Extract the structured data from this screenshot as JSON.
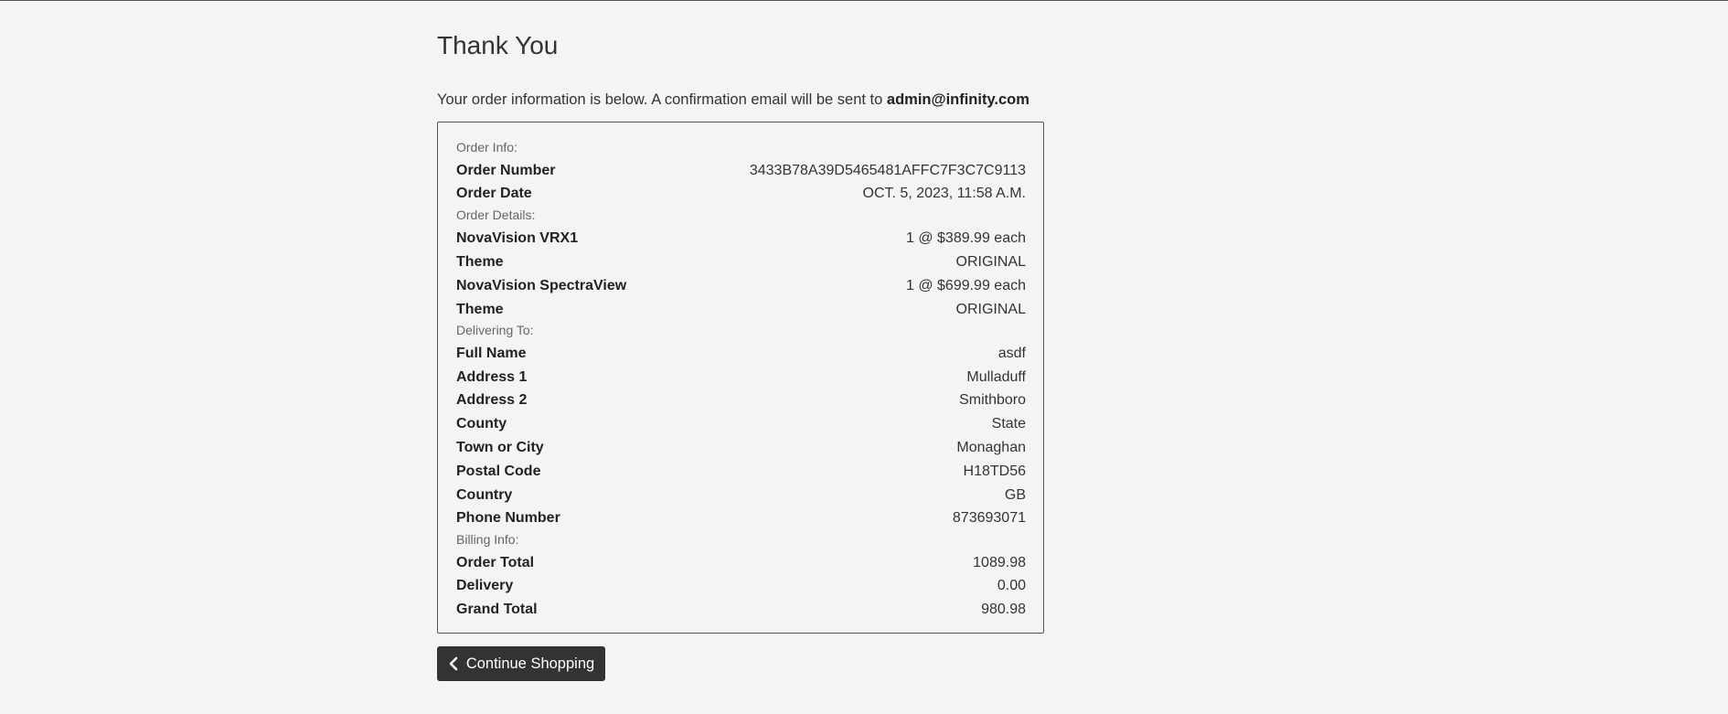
{
  "page": {
    "title": "Thank You",
    "intro_text": "Your order information is below. A confirmation email will be sent to ",
    "email": "admin@infinity.com"
  },
  "order_info": {
    "heading": "Order Info:",
    "rows": [
      {
        "label": "Order Number",
        "value": "3433B78A39D5465481AFFC7F3C7C9113"
      },
      {
        "label": "Order Date",
        "value": "OCT. 5, 2023, 11:58 A.M."
      }
    ]
  },
  "order_details": {
    "heading": "Order Details:",
    "rows": [
      {
        "label": "NovaVision VRX1",
        "value": "1 @ $389.99 each"
      },
      {
        "label": "Theme",
        "value": "ORIGINAL"
      },
      {
        "label": "NovaVision SpectraView",
        "value": "1 @ $699.99 each"
      },
      {
        "label": "Theme",
        "value": "ORIGINAL"
      }
    ]
  },
  "delivering_to": {
    "heading": "Delivering To:",
    "rows": [
      {
        "label": "Full Name",
        "value": "asdf"
      },
      {
        "label": "Address 1",
        "value": "Mulladuff"
      },
      {
        "label": "Address 2",
        "value": "Smithboro"
      },
      {
        "label": "County",
        "value": "State"
      },
      {
        "label": "Town or City",
        "value": "Monaghan"
      },
      {
        "label": "Postal Code",
        "value": "H18TD56"
      },
      {
        "label": "Country",
        "value": "GB"
      },
      {
        "label": "Phone Number",
        "value": "873693071"
      }
    ]
  },
  "billing_info": {
    "heading": "Billing Info:",
    "rows": [
      {
        "label": "Order Total",
        "value": "1089.98"
      },
      {
        "label": "Delivery",
        "value": "0.00"
      },
      {
        "label": "Grand Total",
        "value": "980.98"
      }
    ]
  },
  "actions": {
    "continue_label": "Continue Shopping",
    "continue_icon": "chevron-left-icon"
  }
}
